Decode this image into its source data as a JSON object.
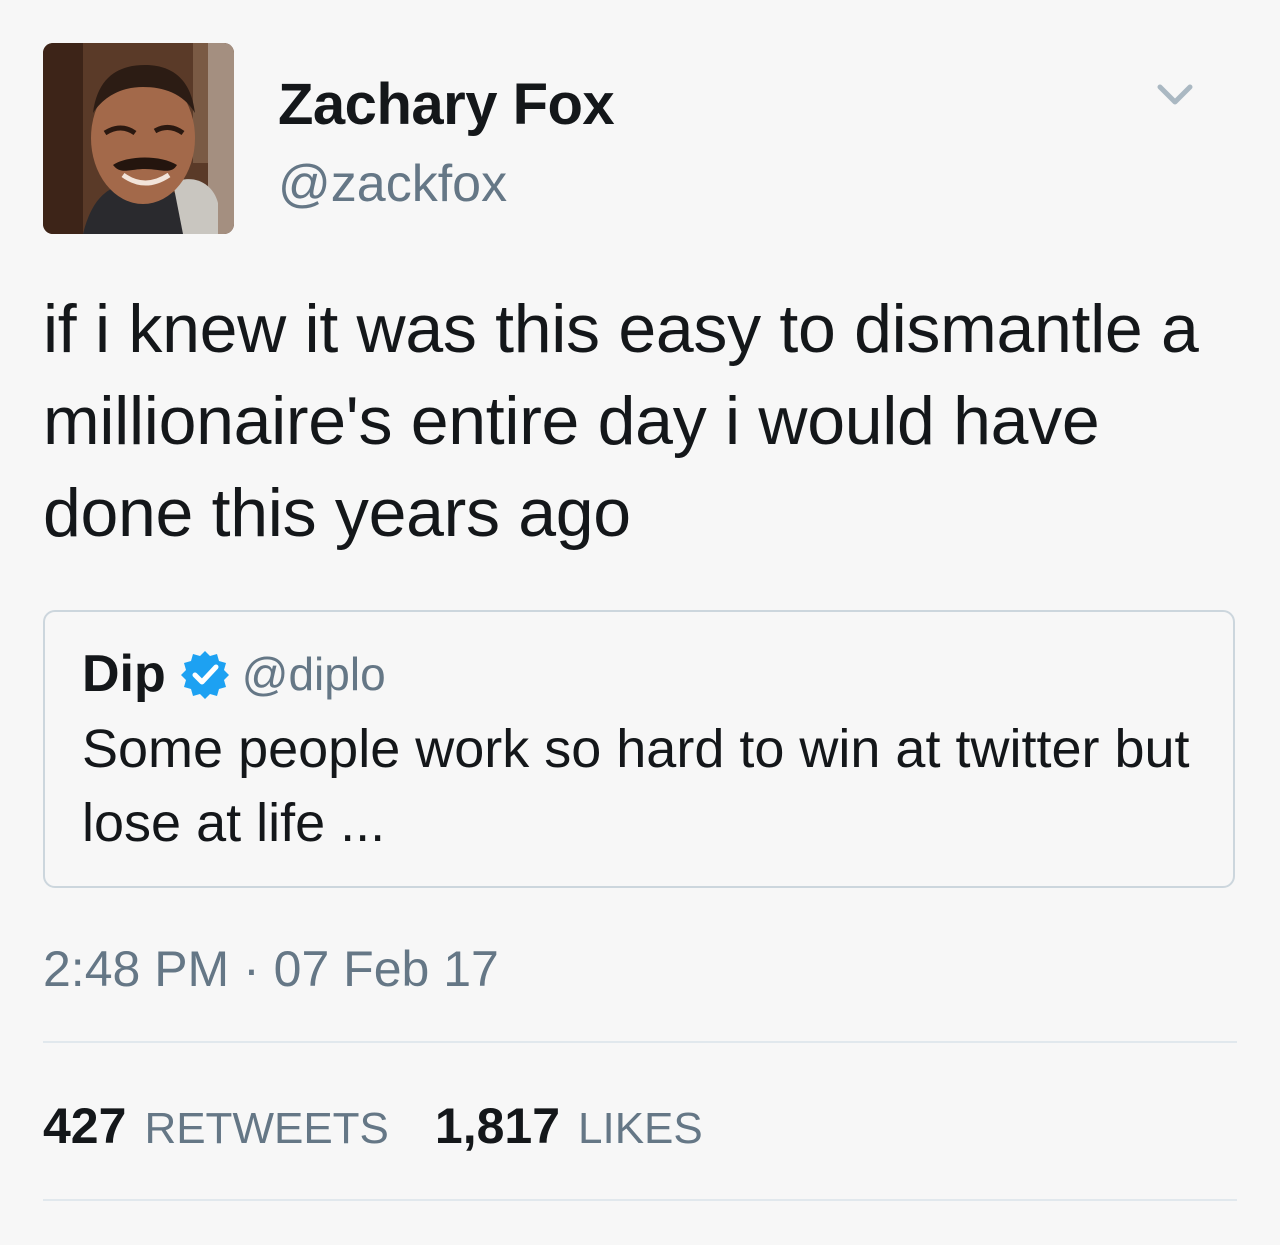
{
  "author": {
    "display_name": "Zachary Fox",
    "handle": "@zackfox",
    "avatar": "profile-photo"
  },
  "tweet": {
    "text": "if i knew it was this easy to dismantle a millionaire's entire day i would have done this years ago",
    "timestamp": "2:48 PM · 07 Feb 17"
  },
  "quoted_tweet": {
    "display_name": "Dip",
    "verified": true,
    "handle": "@diplo",
    "text": "Some people work so hard to win at twitter but lose at life ..."
  },
  "stats": {
    "retweets_count": "427",
    "retweets_label": "RETWEETS",
    "likes_count": "1,817",
    "likes_label": "LIKES"
  },
  "icons": {
    "menu": "chevron-down-icon",
    "verified": "verified-badge-icon"
  },
  "colors": {
    "background": "#f7f7f7",
    "text": "#14171a",
    "secondary_text": "#657786",
    "border": "#ccd6dd",
    "verified_blue": "#1da1f2"
  }
}
